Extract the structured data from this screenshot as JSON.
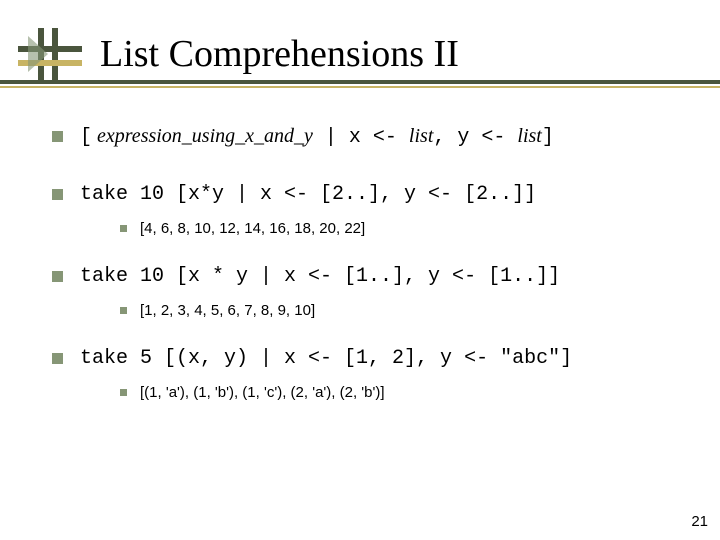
{
  "title": "List Comprehensions II",
  "item1": {
    "lbracket": "[",
    "expr_italic": " expression_using_x_and_y",
    "mid": "  | x <- ",
    "list1_italic": "list",
    "sep": ", y <- ",
    "list2_italic": "list",
    "rbracket": "]"
  },
  "item2": {
    "code": "take 10 [x*y | x <- [2..], y <- [2..]]",
    "result": "[4, 6, 8, 10, 12, 14, 16, 18, 20, 22]"
  },
  "item3": {
    "code": "take 10 [x * y | x <- [1..], y <- [1..]]",
    "result": "[1, 2, 3, 4, 5, 6, 7, 8, 9, 10]"
  },
  "item4": {
    "code": "take 5 [(x, y) | x <- [1, 2], y <- \"abc\"]",
    "result": "[(1, 'a'), (1, 'b'), (1, 'c'), (2, 'a'), (2, 'b')]"
  },
  "page_number": "21"
}
